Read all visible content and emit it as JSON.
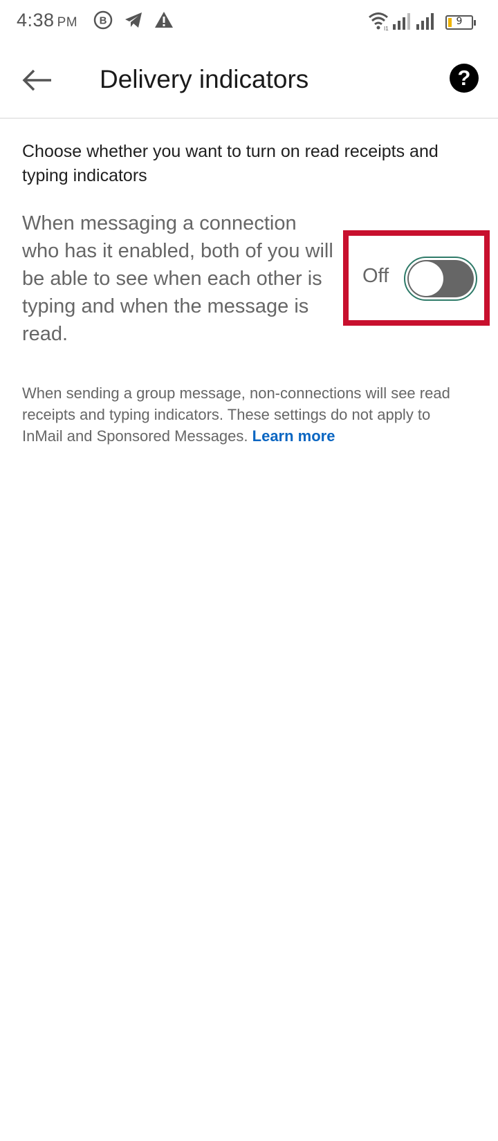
{
  "status_bar": {
    "time": "4:38",
    "ampm": "PM",
    "battery_level": "9",
    "icons": [
      "b-badge-icon",
      "telegram-icon",
      "alert-icon",
      "wifi-icon",
      "signal-icon",
      "signal-icon",
      "battery-icon"
    ]
  },
  "header": {
    "title": "Delivery indicators",
    "back_icon": "arrow-left-icon",
    "help_icon": "question-circle-icon",
    "help_glyph": "?"
  },
  "content": {
    "intro": "Choose whether you want to turn on read receipts and typing indicators",
    "description": "When messaging a connection who has it enabled, both of you will be able to see when each other is typing and when the message is read.",
    "toggle": {
      "state_label": "Off",
      "is_on": false
    },
    "footnote": "When sending a group message, non-connections will see read receipts and typing indicators. These settings do not apply to InMail and Sponsored Messages. ",
    "learn_more": "Learn more"
  },
  "colors": {
    "link": "#0a66c2",
    "highlight_box": "#c8102e",
    "toggle_track_off": "#666666",
    "toggle_border": "#2e7a68",
    "battery_fill": "#f0b400"
  }
}
